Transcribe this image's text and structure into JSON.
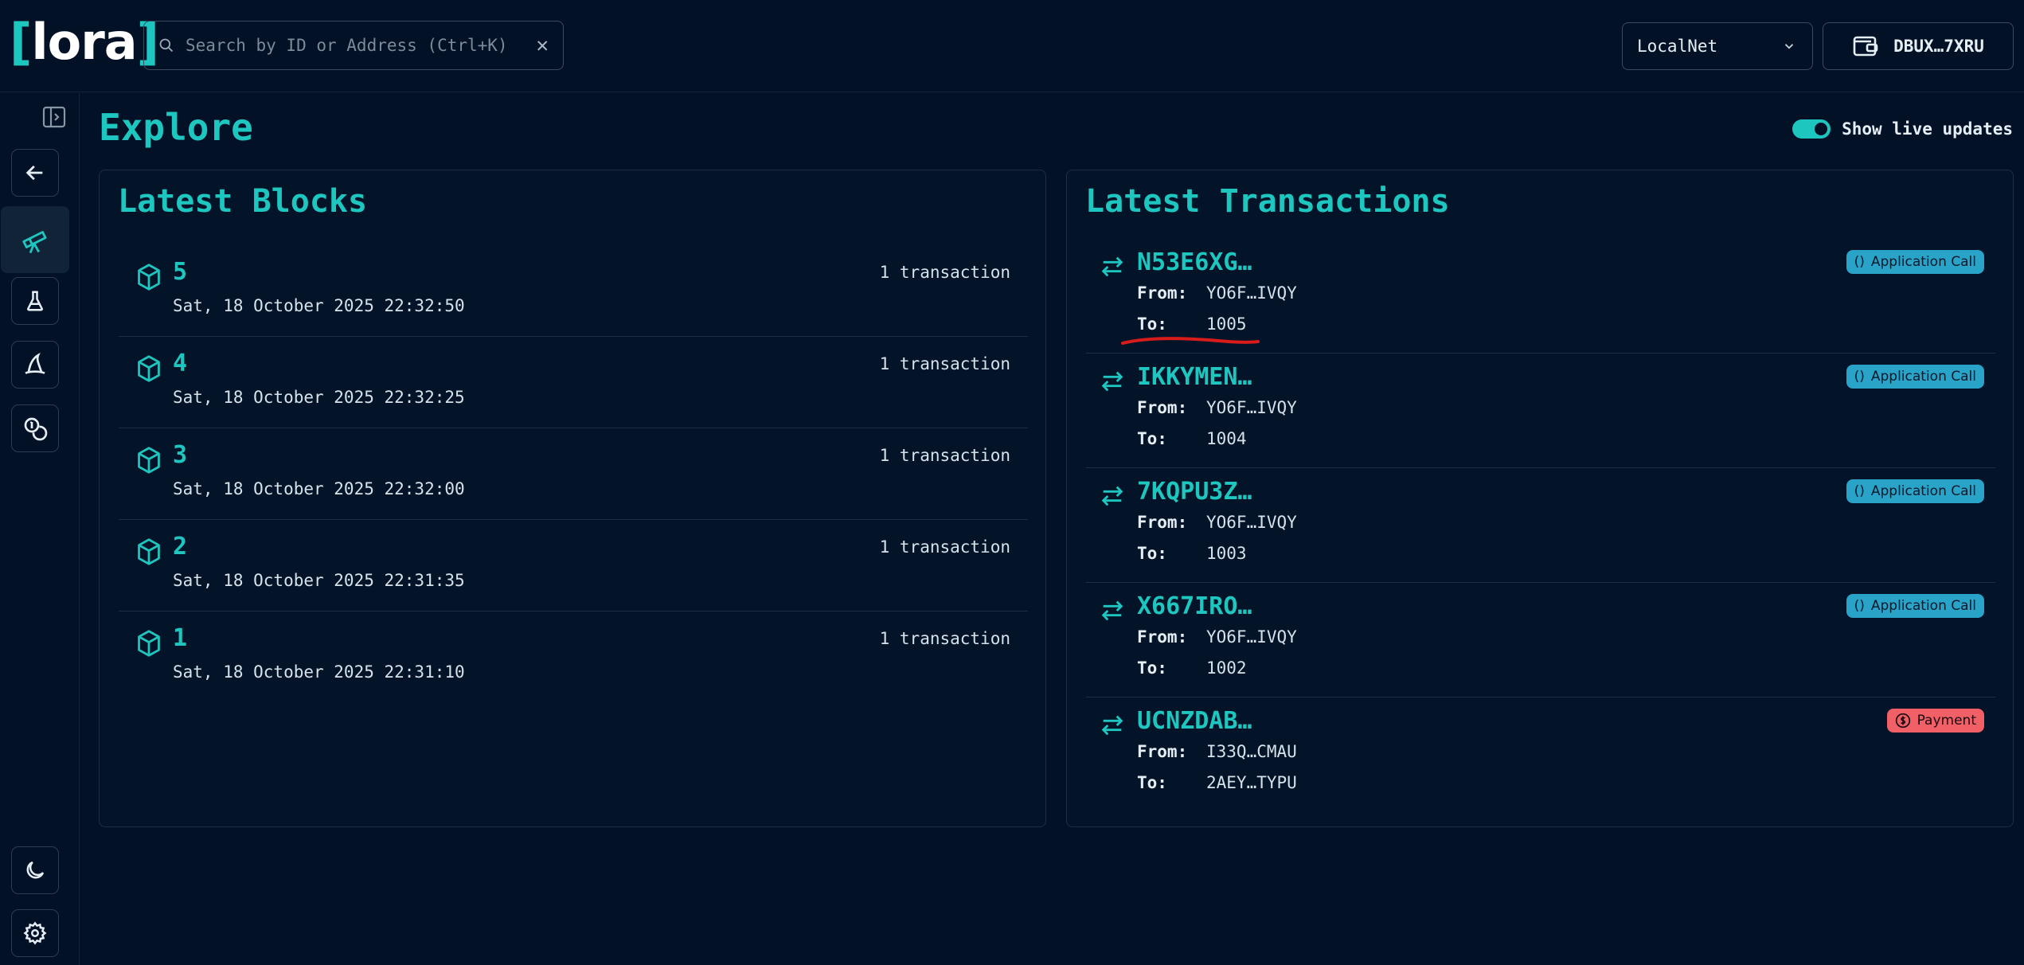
{
  "app": {
    "logo_left_bracket": "[",
    "logo_text": "lora",
    "logo_right_bracket": "]"
  },
  "search": {
    "placeholder": "Search by ID or Address (Ctrl+K)",
    "value": "",
    "clear_label": "✕"
  },
  "network": {
    "selected": "LocalNet"
  },
  "wallet": {
    "address": "DBUX…7XRU"
  },
  "sidebar": {
    "items": [
      {
        "icon": "panel-toggle-icon"
      },
      {
        "icon": "arrow-left-icon"
      },
      {
        "icon": "telescope-icon",
        "active": true
      },
      {
        "icon": "flask-icon"
      },
      {
        "icon": "wizard-hat-icon"
      },
      {
        "icon": "coins-icon"
      }
    ],
    "bottom": [
      {
        "icon": "moon-icon"
      },
      {
        "icon": "gear-icon"
      }
    ]
  },
  "page": {
    "title": "Explore",
    "live_updates_label": "Show live updates",
    "live_updates_on": true
  },
  "latest_blocks": {
    "title": "Latest Blocks",
    "items": [
      {
        "number": "5",
        "date": "Sat, 18 October 2025 22:32:50",
        "count": "1 transaction"
      },
      {
        "number": "4",
        "date": "Sat, 18 October 2025 22:32:25",
        "count": "1 transaction"
      },
      {
        "number": "3",
        "date": "Sat, 18 October 2025 22:32:00",
        "count": "1 transaction"
      },
      {
        "number": "2",
        "date": "Sat, 18 October 2025 22:31:35",
        "count": "1 transaction"
      },
      {
        "number": "1",
        "date": "Sat, 18 October 2025 22:31:10",
        "count": "1 transaction"
      }
    ]
  },
  "latest_transactions": {
    "title": "Latest Transactions",
    "from_label": "From:",
    "to_label": "To:",
    "items": [
      {
        "id": "N53E6XG…",
        "from": "YO6F…IVQY",
        "to": "1005",
        "type": "Application Call",
        "type_icon": "()"
      },
      {
        "id": "IKKYMEN…",
        "from": "YO6F…IVQY",
        "to": "1004",
        "type": "Application Call",
        "type_icon": "()"
      },
      {
        "id": "7KQPU3Z…",
        "from": "YO6F…IVQY",
        "to": "1003",
        "type": "Application Call",
        "type_icon": "()"
      },
      {
        "id": "X667IRO…",
        "from": "YO6F…IVQY",
        "to": "1002",
        "type": "Application Call",
        "type_icon": "()"
      },
      {
        "id": "UCNZDAB…",
        "from": "I33Q…CMAU",
        "to": "2AEY…TYPU",
        "type": "Payment",
        "type_icon": "dollar-circle-icon"
      }
    ]
  },
  "colors": {
    "background": "#021126",
    "accent": "#1ec6c0",
    "app_call_badge": "#2aa3c8",
    "payment_badge": "#f15f67",
    "annotation": "#d81b1b"
  }
}
